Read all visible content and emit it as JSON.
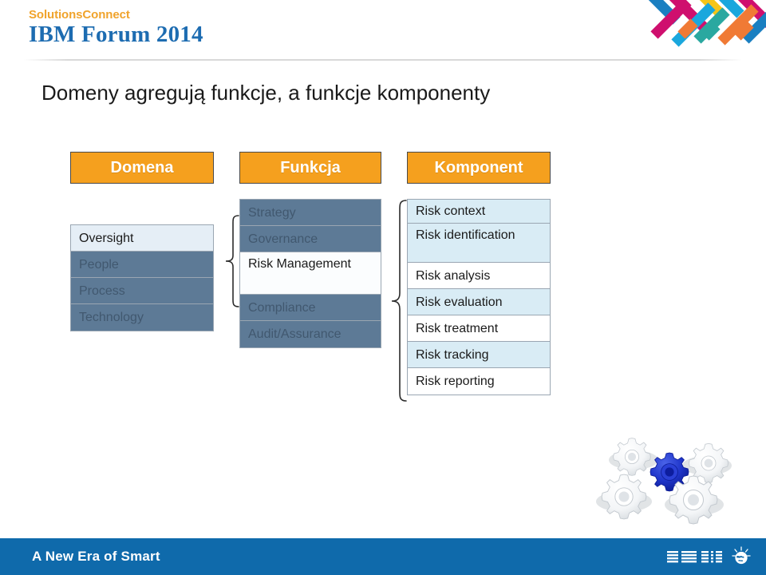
{
  "header": {
    "brand_line1": "SolutionsConnect",
    "brand_line2": "IBM Forum 2014",
    "logo_icon": "solutionsconnect-chevron-logo",
    "brand_orange": "#f0a32b",
    "brand_blue": "#1d6cb1"
  },
  "title": "Domeny agregują funkcje, a funkcje komponenty",
  "diagram": {
    "columns": [
      {
        "id": "domena",
        "header": "Domena",
        "rows": [
          {
            "label": "Oversight",
            "state": "highlighted"
          },
          {
            "label": "People",
            "state": "dimmed"
          },
          {
            "label": "Process",
            "state": "dimmed"
          },
          {
            "label": "Technology",
            "state": "dimmed"
          }
        ]
      },
      {
        "id": "funkcja",
        "header": "Funkcja",
        "rows": [
          {
            "label": "Strategy",
            "state": "dimmed"
          },
          {
            "label": "Governance",
            "state": "dimmed"
          },
          {
            "label": "Risk Management",
            "state": "highlighted"
          },
          {
            "label": "Compliance",
            "state": "dimmed"
          },
          {
            "label": "Audit/Assurance",
            "state": "dimmed"
          }
        ]
      },
      {
        "id": "komponent",
        "header": "Komponent",
        "rows": [
          {
            "label": "Risk context",
            "state": "tint"
          },
          {
            "label": "Risk identification",
            "state": "tint"
          },
          {
            "label": "Risk analysis",
            "state": "plain"
          },
          {
            "label": "Risk evaluation",
            "state": "tint"
          },
          {
            "label": "Risk treatment",
            "state": "plain"
          },
          {
            "label": "Risk tracking",
            "state": "tint"
          },
          {
            "label": "Risk reporting",
            "state": "plain"
          }
        ]
      }
    ],
    "connectors": [
      {
        "name": "brace-oversight-to-funkcja",
        "from": "Oversight",
        "to": "Funkcja column"
      },
      {
        "name": "brace-riskmanagement-to-komponent",
        "from": "Risk Management",
        "to": "Komponent column"
      }
    ],
    "colors": {
      "header_box": "#f5a01e",
      "header_border": "#4a4a4a",
      "row_dimmed_bg": "#5d7a96",
      "row_dimmed_text": "#41586f",
      "row_highlight_bg": "#e5eef6",
      "row_tint_bg": "#d9ecf5",
      "row_border": "#9aa6b2"
    }
  },
  "decoration": {
    "gears_icon": "gears-cluster-icon",
    "gear_accent_color": "#1431c8",
    "gear_body_color": "#f2f4f6"
  },
  "footer": {
    "tagline": "A New Era of Smart",
    "logo_text": "IBM",
    "logo_icon": "smarter-planet-globe-icon",
    "background": "#0f6aab"
  }
}
